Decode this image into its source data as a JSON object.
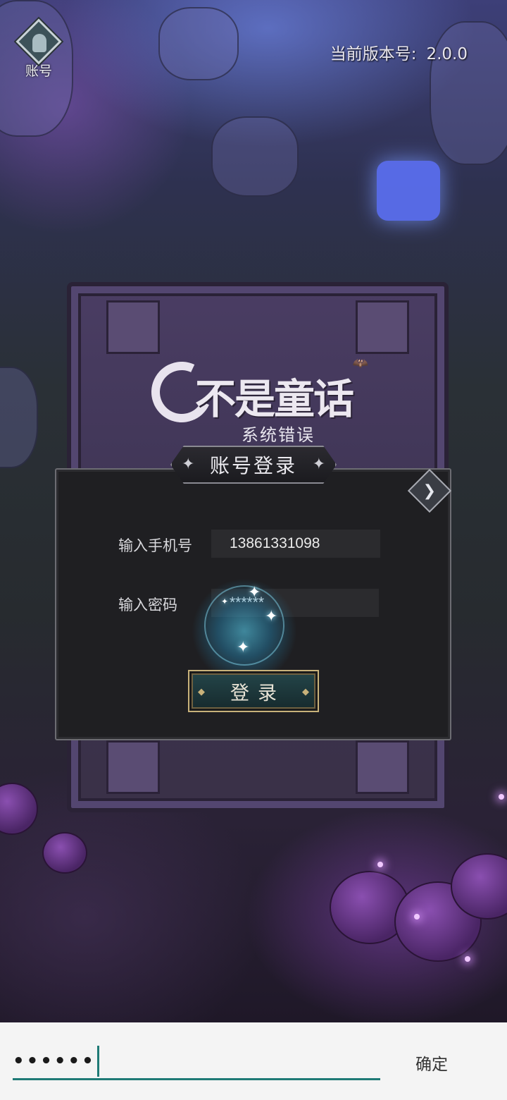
{
  "header": {
    "account_label": "账号",
    "version_label": "当前版本号:",
    "version_value": "2.0.0"
  },
  "logo": {
    "title": "不是童话",
    "subtitle": "系统错误"
  },
  "dialog": {
    "title": "账号登录",
    "title_ornament": "✦",
    "close_icon": "close-icon",
    "phone_label": "输入手机号",
    "phone_value": "13861331098",
    "password_label": "输入密码",
    "password_value": "******",
    "login_label": "登录"
  },
  "ime": {
    "text": "••••••",
    "confirm_label": "确定"
  },
  "colors": {
    "accent": "#1f7a76",
    "gold": "#c8b27a",
    "panel": "#1f1f22"
  }
}
